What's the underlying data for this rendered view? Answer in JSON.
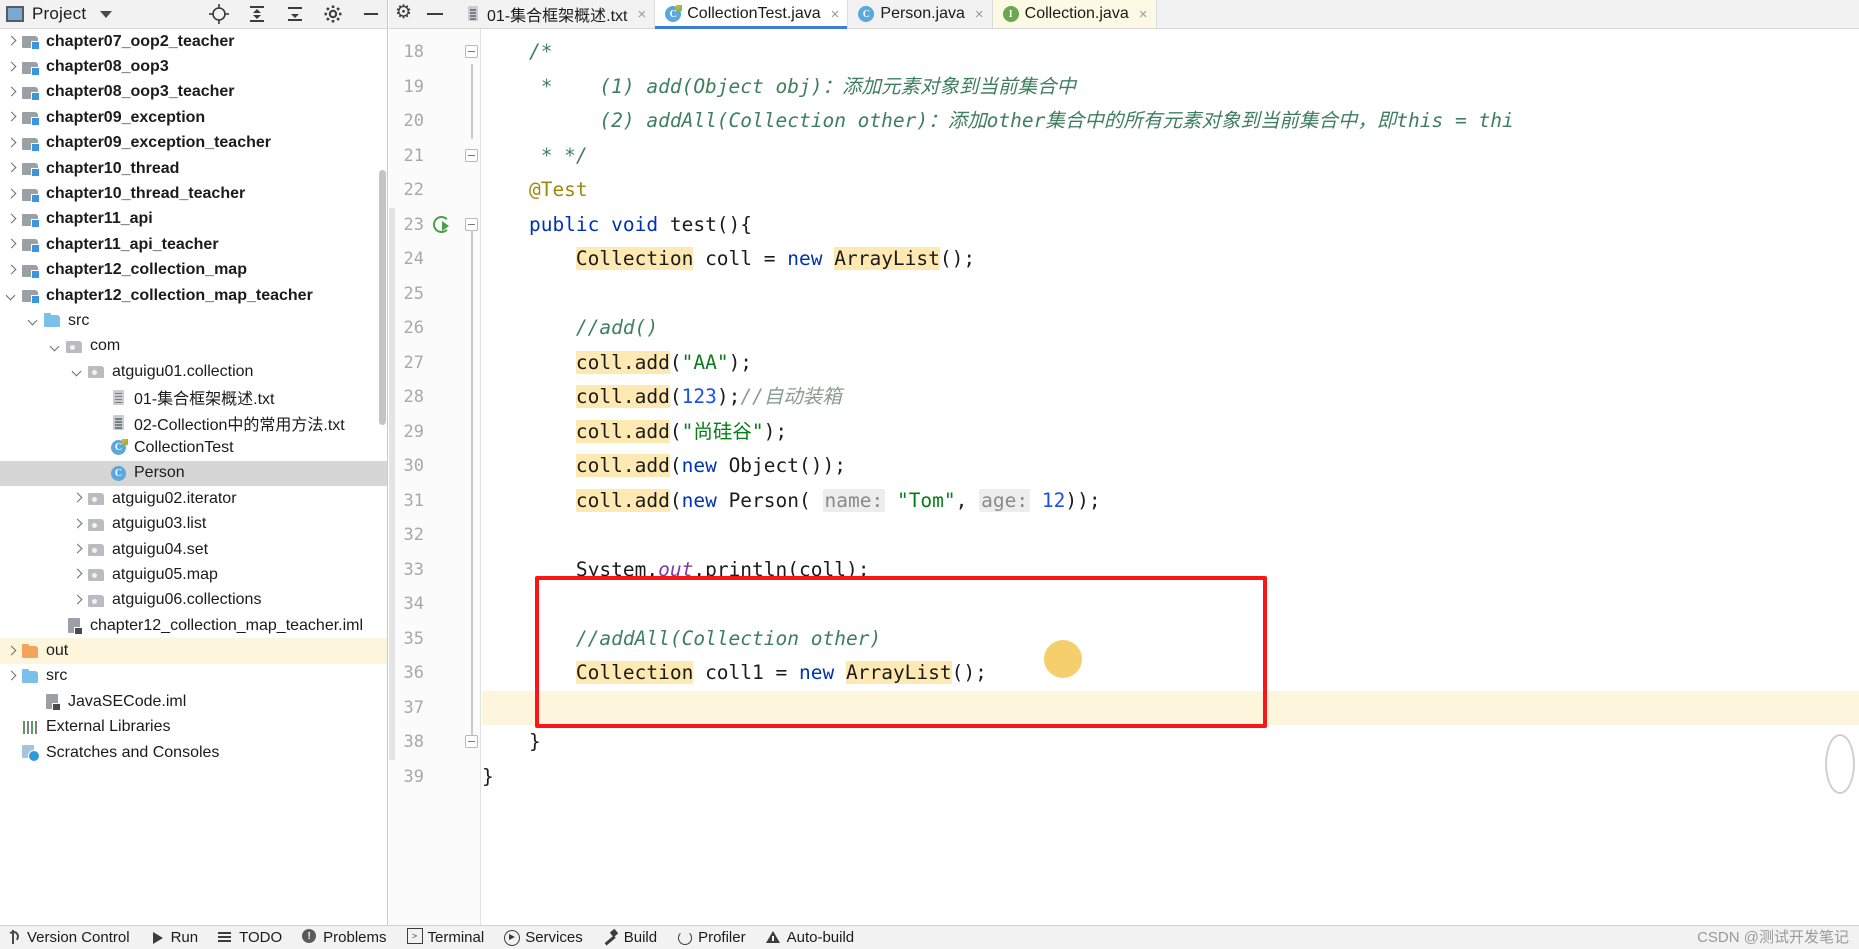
{
  "project_panel": {
    "title": "Project",
    "toolbar_icons": [
      "target-icon",
      "expand-all-icon",
      "collapse-all-icon",
      "gear-icon",
      "minimize-icon"
    ],
    "tree": [
      {
        "label": "chapter07_oop2_teacher",
        "indent": 0,
        "arrow": "right",
        "icon": "module-folder-icon",
        "bold": true,
        "state": "normal"
      },
      {
        "label": "chapter08_oop3",
        "indent": 0,
        "arrow": "right",
        "icon": "module-folder-icon",
        "bold": true,
        "state": "normal"
      },
      {
        "label": "chapter08_oop3_teacher",
        "indent": 0,
        "arrow": "right",
        "icon": "module-folder-icon",
        "bold": true,
        "state": "normal"
      },
      {
        "label": "chapter09_exception",
        "indent": 0,
        "arrow": "right",
        "icon": "module-folder-icon",
        "bold": true,
        "state": "normal"
      },
      {
        "label": "chapter09_exception_teacher",
        "indent": 0,
        "arrow": "right",
        "icon": "module-folder-icon",
        "bold": true,
        "state": "normal"
      },
      {
        "label": "chapter10_thread",
        "indent": 0,
        "arrow": "right",
        "icon": "module-folder-icon",
        "bold": true,
        "state": "normal"
      },
      {
        "label": "chapter10_thread_teacher",
        "indent": 0,
        "arrow": "right",
        "icon": "module-folder-icon",
        "bold": true,
        "state": "normal"
      },
      {
        "label": "chapter11_api",
        "indent": 0,
        "arrow": "right",
        "icon": "module-folder-icon",
        "bold": true,
        "state": "normal"
      },
      {
        "label": "chapter11_api_teacher",
        "indent": 0,
        "arrow": "right",
        "icon": "module-folder-icon",
        "bold": true,
        "state": "normal"
      },
      {
        "label": "chapter12_collection_map",
        "indent": 0,
        "arrow": "right",
        "icon": "module-folder-icon",
        "bold": true,
        "state": "normal"
      },
      {
        "label": "chapter12_collection_map_teacher",
        "indent": 0,
        "arrow": "down",
        "icon": "module-folder-icon",
        "bold": true,
        "state": "normal"
      },
      {
        "label": "src",
        "indent": 1,
        "arrow": "down",
        "icon": "source-folder-icon",
        "bold": false,
        "state": "normal"
      },
      {
        "label": "com",
        "indent": 2,
        "arrow": "down",
        "icon": "package-icon",
        "bold": false,
        "state": "normal"
      },
      {
        "label": "atguigu01.collection",
        "indent": 3,
        "arrow": "down",
        "icon": "package-icon",
        "bold": false,
        "state": "normal"
      },
      {
        "label": "01-集合框架概述.txt",
        "indent": 4,
        "arrow": "none",
        "icon": "text-file-icon",
        "bold": false,
        "state": "normal"
      },
      {
        "label": "02-Collection中的常用方法.txt",
        "indent": 4,
        "arrow": "none",
        "icon": "text-file-icon",
        "bold": false,
        "state": "normal"
      },
      {
        "label": "CollectionTest",
        "indent": 4,
        "arrow": "none",
        "icon": "java-class-runnable-icon",
        "bold": false,
        "state": "normal"
      },
      {
        "label": "Person",
        "indent": 4,
        "arrow": "none",
        "icon": "java-class-icon",
        "bold": false,
        "state": "selected"
      },
      {
        "label": "atguigu02.iterator",
        "indent": 3,
        "arrow": "right",
        "icon": "package-icon",
        "bold": false,
        "state": "normal"
      },
      {
        "label": "atguigu03.list",
        "indent": 3,
        "arrow": "right",
        "icon": "package-icon",
        "bold": false,
        "state": "normal"
      },
      {
        "label": "atguigu04.set",
        "indent": 3,
        "arrow": "right",
        "icon": "package-icon",
        "bold": false,
        "state": "normal"
      },
      {
        "label": "atguigu05.map",
        "indent": 3,
        "arrow": "right",
        "icon": "package-icon",
        "bold": false,
        "state": "normal"
      },
      {
        "label": "atguigu06.collections",
        "indent": 3,
        "arrow": "right",
        "icon": "package-icon",
        "bold": false,
        "state": "normal"
      },
      {
        "label": "chapter12_collection_map_teacher.iml",
        "indent": 2,
        "arrow": "none",
        "icon": "iml-file-icon",
        "bold": false,
        "state": "normal"
      },
      {
        "label": "out",
        "indent": 0,
        "arrow": "right",
        "icon": "excluded-folder-icon",
        "bold": false,
        "state": "highlighted"
      },
      {
        "label": "src",
        "indent": 0,
        "arrow": "right",
        "icon": "source-folder-icon",
        "bold": false,
        "state": "normal"
      },
      {
        "label": "JavaSECode.iml",
        "indent": 1,
        "arrow": "none",
        "icon": "iml-file-icon",
        "bold": false,
        "state": "normal"
      },
      {
        "label": "External Libraries",
        "indent": 0,
        "arrow": "none",
        "icon": "libraries-icon",
        "bold": false,
        "state": "normal"
      },
      {
        "label": "Scratches and Consoles",
        "indent": 0,
        "arrow": "none",
        "icon": "scratches-icon",
        "bold": false,
        "state": "normal"
      }
    ]
  },
  "editor": {
    "window_controls": [
      "gear-icon",
      "minimize-icon"
    ],
    "tabs": [
      {
        "label": "01-集合框架概述.txt",
        "icon": "text-file-icon",
        "active": false,
        "yellow": false,
        "close": "×"
      },
      {
        "label": "CollectionTest.java",
        "icon": "java-class-runnable-icon",
        "active": true,
        "yellow": false,
        "close": "×"
      },
      {
        "label": "Person.java",
        "icon": "java-class-icon",
        "active": false,
        "yellow": false,
        "close": "×"
      },
      {
        "label": "Collection.java",
        "icon": "java-interface-icon",
        "active": false,
        "yellow": true,
        "close": "×"
      }
    ],
    "first_line_number": 18,
    "line_numbers": [
      18,
      19,
      20,
      21,
      22,
      23,
      24,
      25,
      26,
      27,
      28,
      29,
      30,
      31,
      32,
      33,
      34,
      35,
      36,
      37,
      38,
      39
    ],
    "code_lines": [
      {
        "n": 18,
        "segments": [
          {
            "t": "    /*",
            "c": "cm"
          }
        ]
      },
      {
        "n": 19,
        "segments": [
          {
            "t": "     *    (1) add(Object obj)：添加元素对象到当前集合中",
            "c": "cm"
          }
        ]
      },
      {
        "n": 20,
        "segments": [
          {
            "t": "          (2) addAll(Collection other)：添加other集合中的所有元素对象到当前集合中，即this = thi",
            "c": "cm"
          }
        ]
      },
      {
        "n": 21,
        "segments": [
          {
            "t": "     * */",
            "c": "cm"
          }
        ]
      },
      {
        "n": 22,
        "segments": [
          {
            "t": "    @Test",
            "c": "an"
          }
        ]
      },
      {
        "n": 23,
        "segments": [
          {
            "t": "    public void ",
            "c": "k"
          },
          {
            "t": "test(){",
            "c": ""
          }
        ]
      },
      {
        "n": 24,
        "segments": [
          {
            "t": "        ",
            "c": ""
          },
          {
            "t": "Collection",
            "c": "hlw"
          },
          {
            "t": " coll = ",
            "c": ""
          },
          {
            "t": "new",
            "c": "k"
          },
          {
            "t": " ",
            "c": ""
          },
          {
            "t": "ArrayList",
            "c": "hlw"
          },
          {
            "t": "();",
            "c": ""
          }
        ]
      },
      {
        "n": 25,
        "segments": []
      },
      {
        "n": 26,
        "segments": [
          {
            "t": "        //add()",
            "c": "cm"
          }
        ]
      },
      {
        "n": 27,
        "segments": [
          {
            "t": "        ",
            "c": ""
          },
          {
            "t": "coll.add",
            "c": "hlw"
          },
          {
            "t": "(",
            "c": ""
          },
          {
            "t": "\"AA\"",
            "c": "st"
          },
          {
            "t": ");",
            "c": ""
          }
        ]
      },
      {
        "n": 28,
        "segments": [
          {
            "t": "        ",
            "c": ""
          },
          {
            "t": "coll.add",
            "c": "hlw"
          },
          {
            "t": "(",
            "c": ""
          },
          {
            "t": "123",
            "c": "nu"
          },
          {
            "t": ");",
            "c": ""
          },
          {
            "t": "//自动装箱",
            "c": "cmg"
          }
        ]
      },
      {
        "n": 29,
        "segments": [
          {
            "t": "        ",
            "c": ""
          },
          {
            "t": "coll.add",
            "c": "hlw"
          },
          {
            "t": "(",
            "c": ""
          },
          {
            "t": "\"尚硅谷\"",
            "c": "st"
          },
          {
            "t": ");",
            "c": ""
          }
        ]
      },
      {
        "n": 30,
        "segments": [
          {
            "t": "        ",
            "c": ""
          },
          {
            "t": "coll.add",
            "c": "hlw"
          },
          {
            "t": "(",
            "c": ""
          },
          {
            "t": "new",
            "c": "k"
          },
          {
            "t": " Object());",
            "c": ""
          }
        ]
      },
      {
        "n": 31,
        "segments": [
          {
            "t": "        ",
            "c": ""
          },
          {
            "t": "coll.add",
            "c": "hlw"
          },
          {
            "t": "(",
            "c": ""
          },
          {
            "t": "new",
            "c": "k"
          },
          {
            "t": " Person( ",
            "c": ""
          },
          {
            "t": "name:",
            "c": "hint"
          },
          {
            "t": " ",
            "c": ""
          },
          {
            "t": "\"Tom\"",
            "c": "st"
          },
          {
            "t": ", ",
            "c": ""
          },
          {
            "t": "age:",
            "c": "hint"
          },
          {
            "t": " ",
            "c": ""
          },
          {
            "t": "12",
            "c": "nu"
          },
          {
            "t": "));",
            "c": ""
          }
        ]
      },
      {
        "n": 32,
        "segments": []
      },
      {
        "n": 33,
        "segments": [
          {
            "t": "        System.",
            "c": ""
          },
          {
            "t": "out",
            "c": "fd"
          },
          {
            "t": ".println(coll);",
            "c": ""
          }
        ]
      },
      {
        "n": 34,
        "segments": []
      },
      {
        "n": 35,
        "segments": [
          {
            "t": "        //addAll(Collection other)",
            "c": "cm"
          }
        ]
      },
      {
        "n": 36,
        "segments": [
          {
            "t": "        ",
            "c": ""
          },
          {
            "t": "Collection",
            "c": "hlw"
          },
          {
            "t": " coll1 = ",
            "c": ""
          },
          {
            "t": "new",
            "c": "k"
          },
          {
            "t": " ",
            "c": ""
          },
          {
            "t": "ArrayList",
            "c": "hlw"
          },
          {
            "t": "();",
            "c": ""
          }
        ]
      },
      {
        "n": 37,
        "segments": []
      },
      {
        "n": 38,
        "segments": [
          {
            "t": "    }",
            "c": ""
          }
        ]
      },
      {
        "n": 39,
        "segments": [
          {
            "t": "}",
            "c": ""
          }
        ]
      }
    ],
    "annotation": {
      "red_box_note": "red-rectangle-highlight around lines 35-38",
      "cursor_dot_color": "#f5cf6b"
    },
    "run_gutter_line": 23,
    "current_line": 37
  },
  "status_bar": {
    "items": [
      {
        "label": "Version Control",
        "icon": "vcs-icon"
      },
      {
        "label": "Run",
        "icon": "run-icon"
      },
      {
        "label": "TODO",
        "icon": "todo-icon"
      },
      {
        "label": "Problems",
        "icon": "problems-icon"
      },
      {
        "label": "Terminal",
        "icon": "terminal-icon"
      },
      {
        "label": "Services",
        "icon": "services-icon"
      },
      {
        "label": "Build",
        "icon": "build-icon"
      },
      {
        "label": "Profiler",
        "icon": "profiler-icon"
      },
      {
        "label": "Auto-build",
        "icon": "auto-build-icon"
      }
    ],
    "watermark": "CSDN @测试开发笔记"
  },
  "colors": {
    "accent": "#3b7dd8",
    "highlight_box": "#fa1616",
    "usage_highlight": "#ffe9b3",
    "selection": "#d6d6d6",
    "excluded_row": "#fdf6dd"
  }
}
